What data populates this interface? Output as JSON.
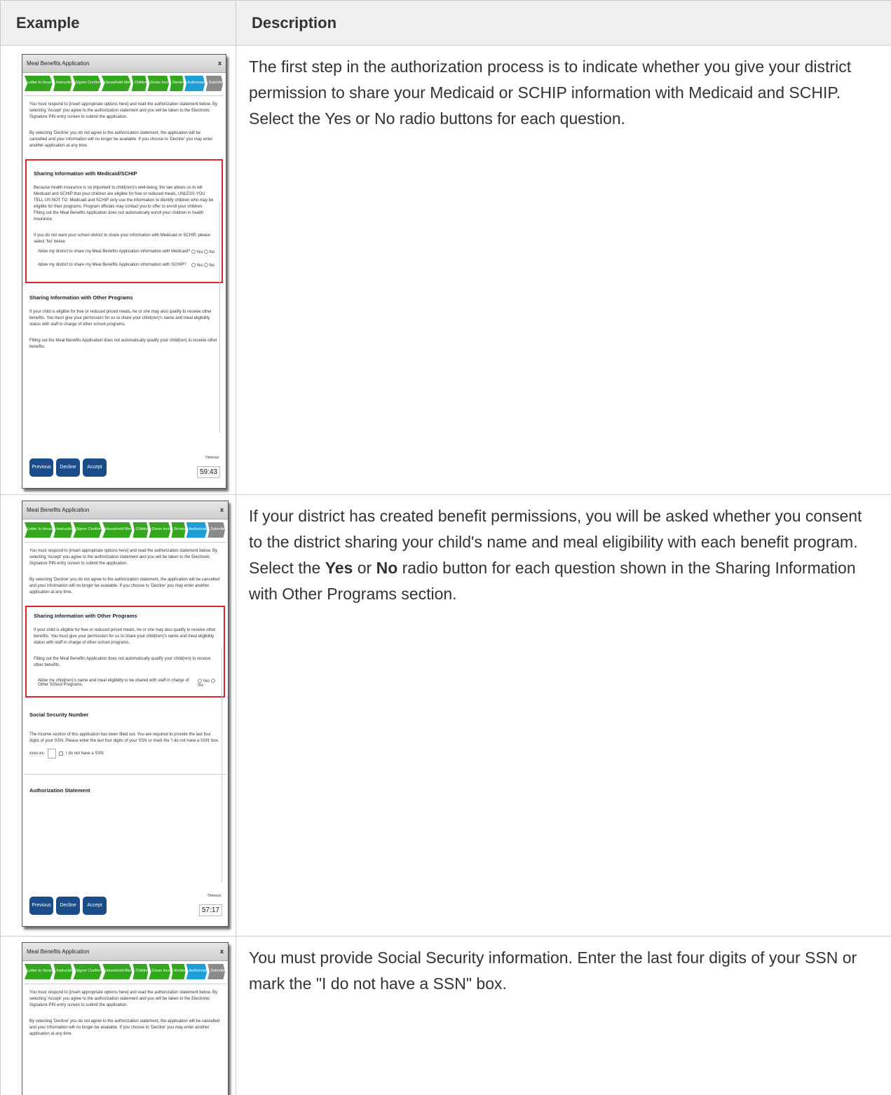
{
  "headers": {
    "example": "Example",
    "description": "Description"
  },
  "rows": [
    {
      "description_parts": [
        "The first step in the authorization process is to indicate whether you give your district permission to share your Medicaid or SCHIP information with Medicaid and SCHIP. Select the Yes or No radio buttons for each question."
      ]
    },
    {
      "desc_a": "If your district has created benefit permissions, you will be asked whether you consent to the district sharing your child's name and meal eligibility with each benefit program. Select the ",
      "desc_yes": "Yes",
      "desc_or": " or ",
      "desc_no": "No",
      "desc_b": " radio button for each question shown in the Sharing Information with Other Programs section."
    },
    {
      "description": "You must provide Social Security information. Enter the last four digits of your SSN or mark the \"I do not have a SSN\" box."
    }
  ],
  "dialog": {
    "title": "Meal Benefits Application",
    "close": "x",
    "steps": [
      "Letter to Household",
      "Instructions",
      "Signer Confirmation",
      "Household Members",
      "Children",
      "Gross Income",
      "Review",
      "Authorization",
      "Submitted"
    ],
    "intro1": "You must respond to [insert appropriate options here] and read the authorization statement below. By selecting 'Accept' you agree to the authorization statement and you will be taken to the Electronic Signature PIN entry screen to submit the application.",
    "intro2": "By selecting 'Decline' you do not agree to the authorization statement, the application will be cancelled and your information will no longer be available. If you choose to 'Decline' you may enter another application at any time.",
    "medicaid_heading": "Sharing Information with Medicaid/SCHIP",
    "medicaid_text": "Because health insurance is so important to child(ren)'s well-being, the law allows us to tell Medicaid and SCHIP that your children are eligible for free or reduced meals, UNLESS YOU TELL US NOT TO. Medicaid and SCHIP only use the information to identify children who may be eligible for their programs. Program officials may contact you to offer to enroll your children. Filling out the Meal Benefits Application does not automatically enroll your children in health insurance.",
    "medicaid_prompt": "If you do not want your school district to share your information with Medicaid or SCHIP, please select 'No' below",
    "q_medicaid": "Allow my district to share my Meal Benefits Application information with Medicaid?",
    "q_schip": "Allow my district to share my Meal Benefits Application information with SCHIP?",
    "yes": "Yes",
    "no": "No",
    "other_heading": "Sharing Information with Other Programs",
    "other_text": "If your child is eligible for free or reduced priced meals, he or she may also qualify to receive other benefits. You must give your permission for us to share your child(ren)'s name and meal eligibility status with staff in charge of other school programs.",
    "other_text2": "Filling out the Meal Benefits Application does not automatically qualify your child(ren) to receive other benefits.",
    "q_other": "Allow my child(ren)'s name and meal eligibility to be shared with staff in charge of Other School Programs.",
    "ssn_heading": "Social Security Number",
    "ssn_text": "The income section of this application has been filled out. You are required to provide the last four digits of your SSN. Please enter the last four digits of your SSN or mark the 'I do not have a SSN' box.",
    "ssn_prefix": "xxxx-xx-",
    "ssn_none": "I do not have a SSN",
    "auth_heading": "Authorization Statement",
    "btn_previous": "Previous",
    "btn_decline": "Decline",
    "btn_accept": "Accept",
    "timeout_label": "Timeout",
    "timeout1": "59:43",
    "timeout2": "57:17"
  }
}
